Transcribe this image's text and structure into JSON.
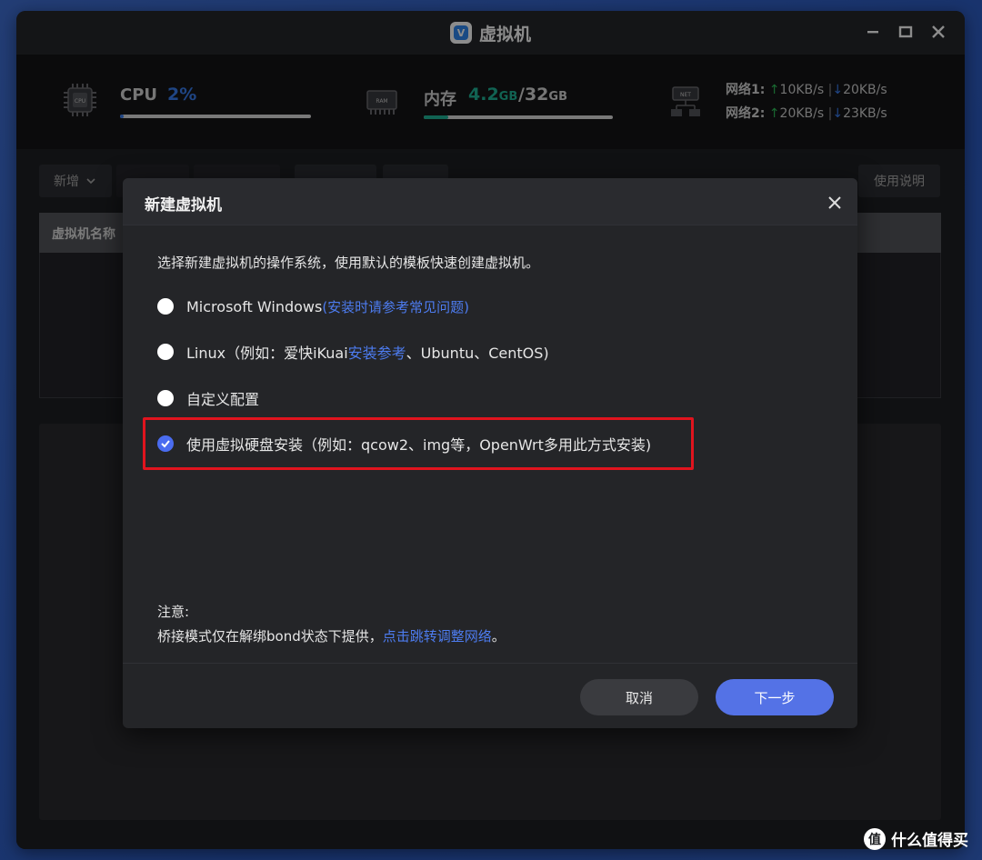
{
  "window": {
    "title": "虚拟机",
    "logo_letter": "V"
  },
  "stats": {
    "cpu": {
      "icon_text": "CPU",
      "label": "CPU",
      "value": "2%",
      "percent": 2
    },
    "memory": {
      "icon_text": "RAM",
      "label": "内存",
      "used": "4.2",
      "used_unit": "GB",
      "sep": "/",
      "total": "32",
      "total_unit": "GB",
      "percent": 13
    },
    "network": {
      "icon_text": "NET",
      "rows": [
        {
          "label": "网络1:",
          "up_arrow": "↑",
          "up": "10KB/s",
          "sep": "|",
          "down_arrow": "↓",
          "down": "20KB/s"
        },
        {
          "label": "网络2:",
          "up_arrow": "↑",
          "up": "20KB/s",
          "sep": "|",
          "down_arrow": "↓",
          "down": "23KB/s"
        }
      ]
    }
  },
  "toolbar": {
    "add_label": "新增",
    "help_label": "使用说明"
  },
  "table": {
    "col_name": "虚拟机名称"
  },
  "dialog": {
    "title": "新建虚拟机",
    "description": "选择新建虚拟机的操作系统，使用默认的模板快速创建虚拟机。",
    "options": [
      {
        "text": "Microsoft Windows ",
        "link": "(安装时请参考常见问题)",
        "checked": false
      },
      {
        "text": "Linux（例如：爱快iKuai",
        "link": "安装参考",
        "suffix": "、Ubuntu、CentOS)",
        "checked": false
      },
      {
        "text": "自定义配置",
        "checked": false
      },
      {
        "text": "使用虚拟硬盘安装（例如：qcow2、img等，OpenWrt多用此方式安装)",
        "checked": true
      }
    ],
    "note_title": "注意:",
    "note_text": "桥接模式仅在解绑bond状态下提供，",
    "note_link": "点击跳转调整网络",
    "note_end": "。",
    "cancel_label": "取消",
    "next_label": "下一步"
  },
  "watermark": {
    "logo": "值",
    "text": "什么值得买"
  },
  "colors": {
    "accent": "#5472e6",
    "link": "#4d7cf0",
    "highlight": "#e0141e",
    "cpu": "#3a7ef0",
    "mem": "#1fb497",
    "up": "#2fc05a"
  }
}
